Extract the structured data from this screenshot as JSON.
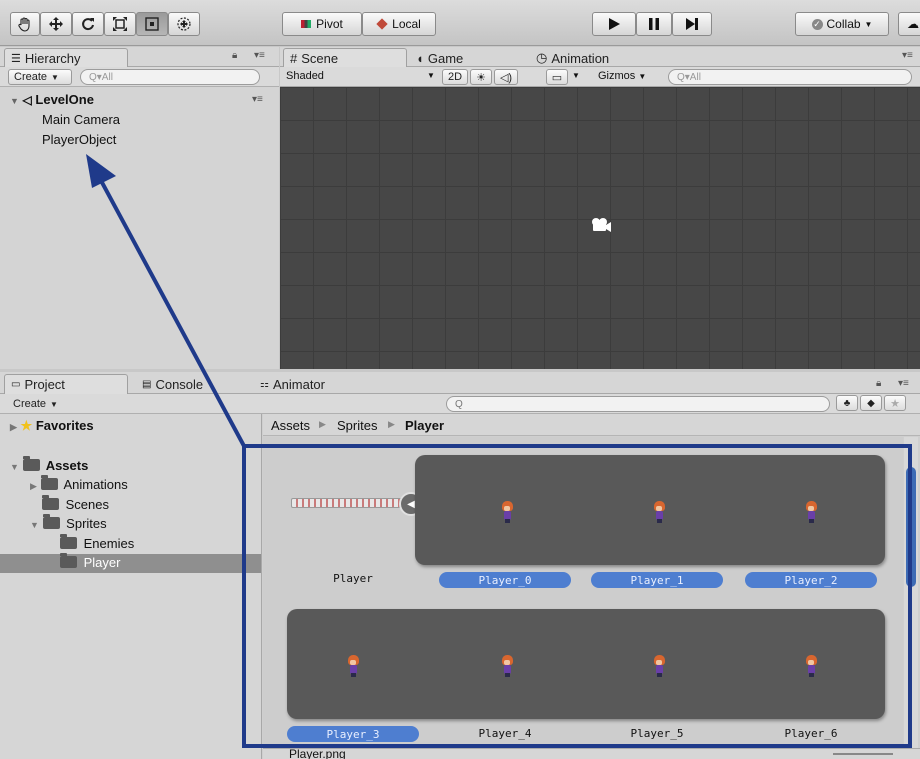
{
  "toolbar": {
    "tools": [
      "hand-tool-icon",
      "move-tool-icon",
      "rotate-tool-icon",
      "scale-tool-icon",
      "rect-tool-icon",
      "transform-tool-icon"
    ],
    "pivot_label": "Pivot",
    "local_label": "Local",
    "collab_label": "Collab"
  },
  "hierarchy": {
    "tab_label": "Hierarchy",
    "create_label": "Create",
    "search_placeholder": "Q▾All",
    "scene_name": "LevelOne",
    "items": [
      "Main Camera",
      "PlayerObject"
    ]
  },
  "scene": {
    "tabs": [
      "Scene",
      "Game",
      "Animation"
    ],
    "shading_mode": "Shaded",
    "mode_2d": "2D",
    "gizmos_label": "Gizmos",
    "search_placeholder": "Q▾All"
  },
  "project": {
    "tabs": [
      "Project",
      "Console",
      "Animator"
    ],
    "create_label": "Create",
    "favorites_label": "Favorites",
    "assets_label": "Assets",
    "folders": [
      "Animations",
      "Scenes",
      "Sprites",
      "Enemies",
      "Player"
    ],
    "breadcrumb": [
      "Assets",
      "Sprites",
      "Player"
    ],
    "parent_asset": "Player",
    "sprites": [
      "Player_0",
      "Player_1",
      "Player_2",
      "Player_3",
      "Player_4",
      "Player_5",
      "Player_6"
    ],
    "selected_file": "Player.png"
  },
  "colors": {
    "accent_blue": "#4e7ed0",
    "annotation": "#1f3a8a",
    "scene_grid": "#474747"
  }
}
